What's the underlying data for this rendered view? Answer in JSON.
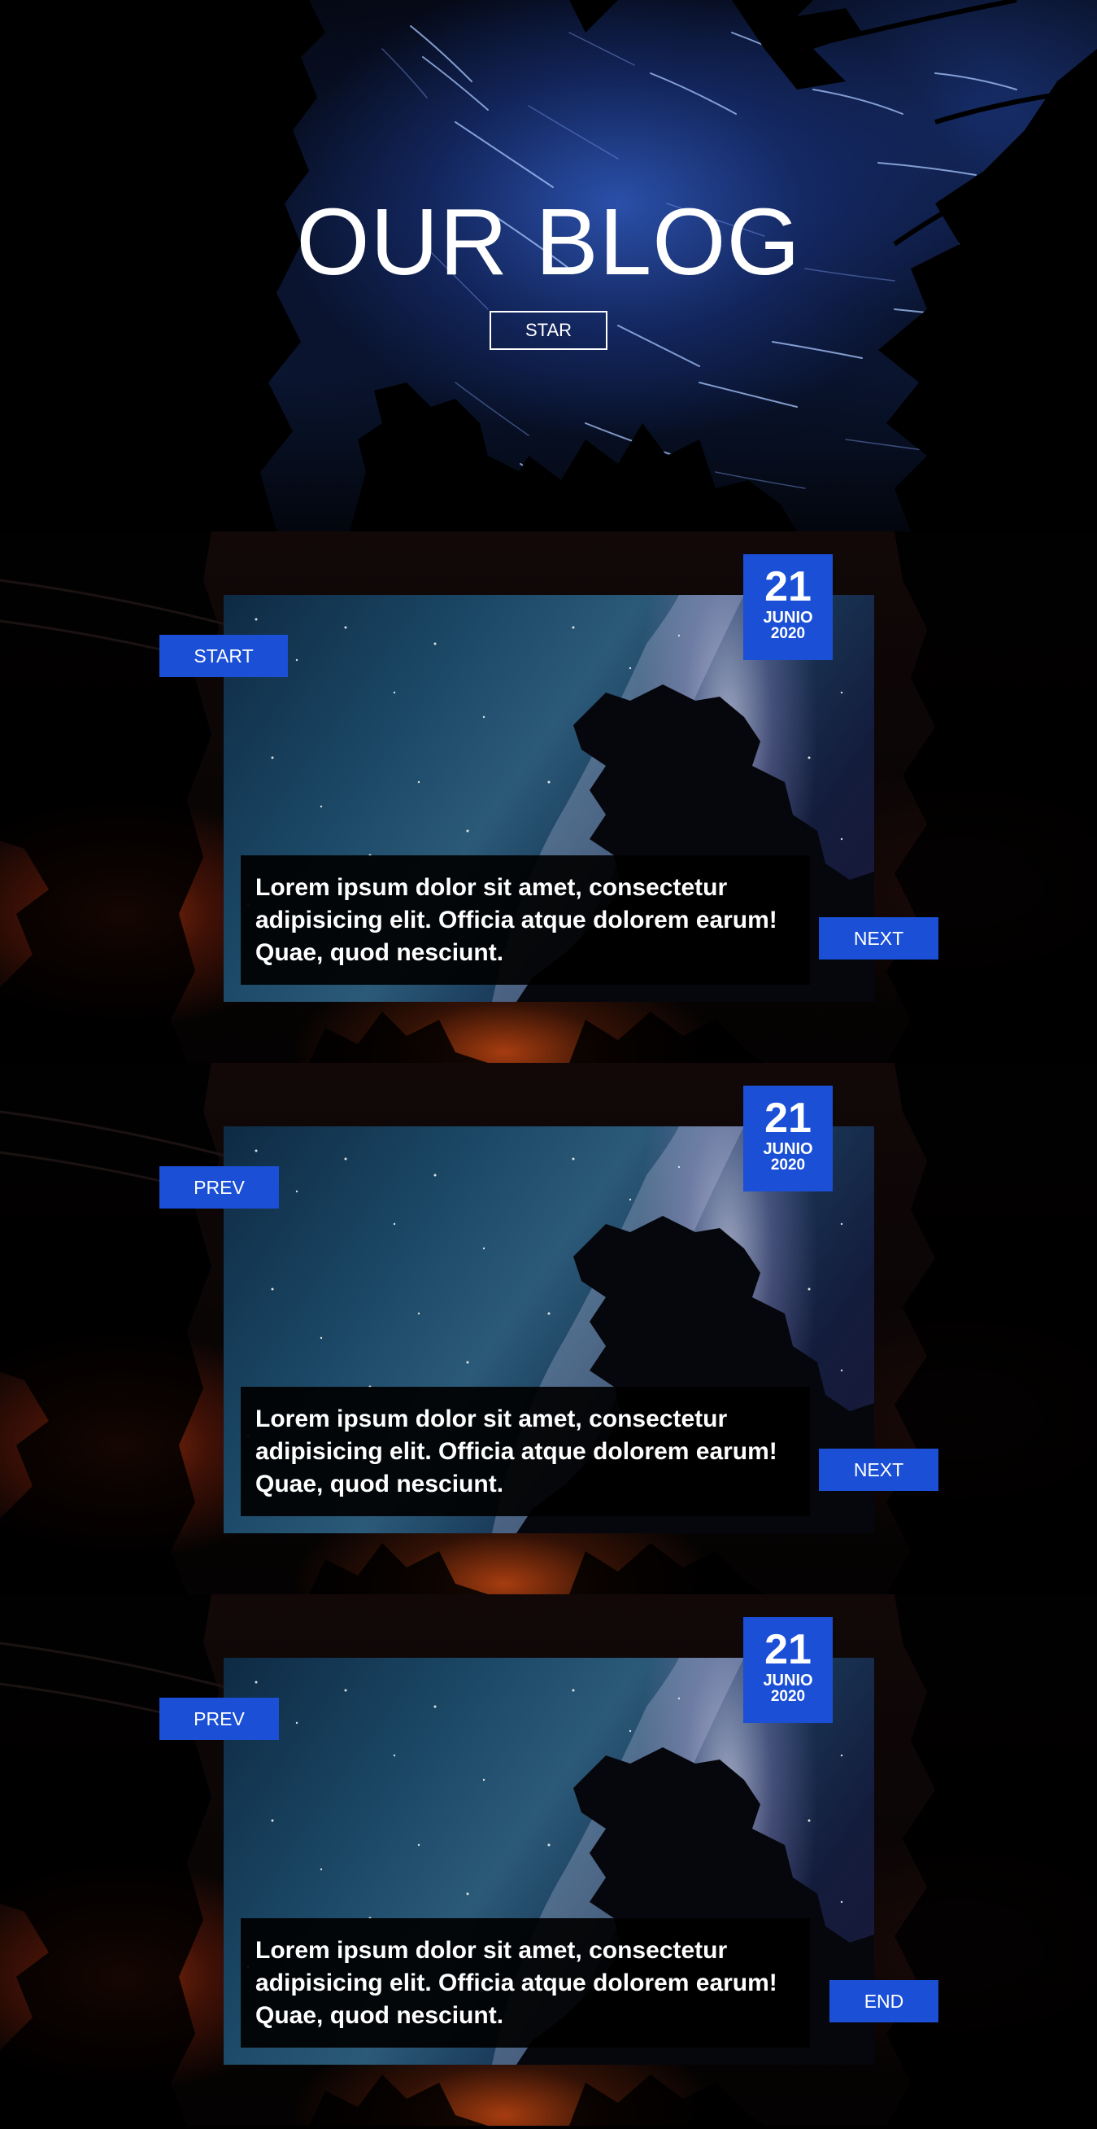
{
  "hero": {
    "title": "OUR BLOG",
    "button_label": "STAR"
  },
  "posts": [
    {
      "date": {
        "day": "21",
        "month": "JUNIO",
        "year": "2020"
      },
      "left_button": "START",
      "right_button": "NEXT",
      "caption": "Lorem ipsum dolor sit amet, consectetur adipisicing elit. Officia atque dolorem earum! Quae, quod nesciunt."
    },
    {
      "date": {
        "day": "21",
        "month": "JUNIO",
        "year": "2020"
      },
      "left_button": "PREV",
      "right_button": "NEXT",
      "caption": "Lorem ipsum dolor sit amet, consectetur adipisicing elit. Officia atque dolorem earum! Quae, quod nesciunt."
    },
    {
      "date": {
        "day": "21",
        "month": "JUNIO",
        "year": "2020"
      },
      "left_button": "PREV",
      "right_button": "END",
      "caption": "Lorem ipsum dolor sit amet, consectetur adipisicing elit. Officia atque dolorem earum! Quae, quod nesciunt."
    }
  ],
  "colors": {
    "accent": "#1a4fd6",
    "background": "#000000",
    "text": "#ffffff"
  }
}
